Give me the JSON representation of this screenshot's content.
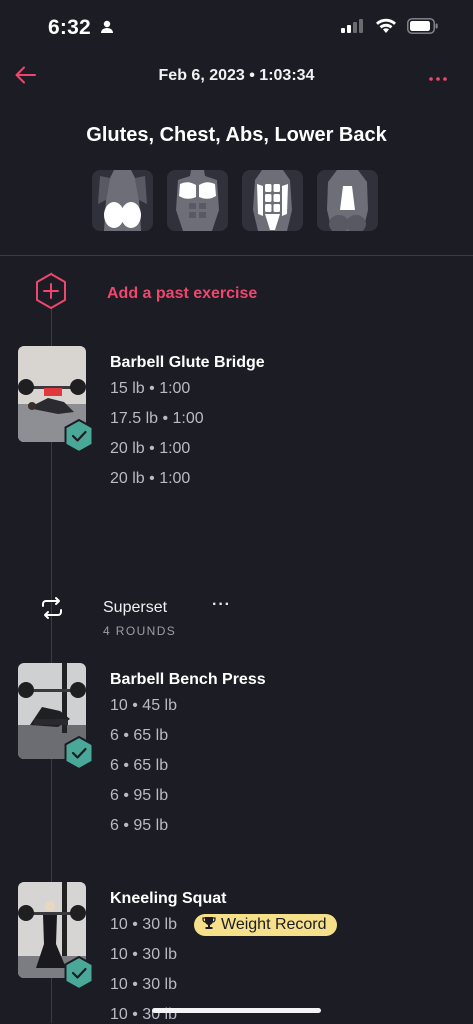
{
  "status": {
    "time": "6:32"
  },
  "nav": {
    "title": "Feb 6, 2023 • 1:03:34"
  },
  "muscles": {
    "title": "Glutes, Chest, Abs, Lower Back",
    "groups": [
      "glutes-icon",
      "chest-icon",
      "abs-icon",
      "lower-back-icon"
    ]
  },
  "add_past": {
    "label": "Add a past exercise"
  },
  "exercises": [
    {
      "name": "Barbell Glute Bridge",
      "sets": [
        "15 lb • 1:00",
        "17.5 lb • 1:00",
        "20 lb • 1:00",
        "20 lb • 1:00"
      ]
    },
    {
      "name": "Barbell Bench Press",
      "sets": [
        "10 • 45 lb",
        "6 • 65 lb",
        "6 • 65 lb",
        "6 • 95 lb",
        "6 • 95 lb"
      ]
    },
    {
      "name": "Kneeling Squat",
      "sets": [
        "10 • 30 lb",
        "10 • 30 lb",
        "10 • 30 lb",
        "10 • 30 lb"
      ],
      "badge": "Weight Record"
    }
  ],
  "superset": {
    "label": "Superset",
    "rounds": "4 ROUNDS",
    "more": "···"
  },
  "colors": {
    "accent": "#f0466d",
    "check": "#4aa898",
    "badge": "#f6e08a",
    "background": "#1c1c24"
  }
}
